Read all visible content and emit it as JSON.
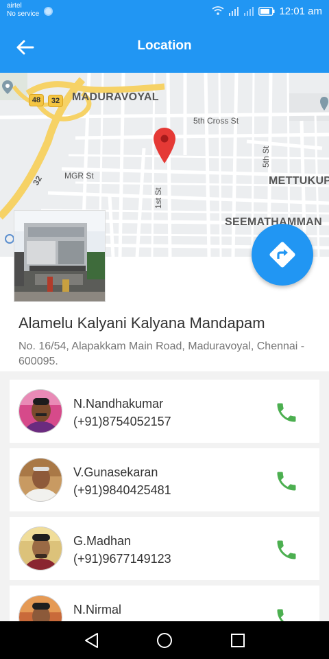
{
  "status_bar": {
    "carrier": "airtel",
    "service": "No service",
    "time": "12:01 am"
  },
  "app_bar": {
    "title": "Location",
    "back_icon": "arrow-left-icon"
  },
  "map": {
    "places": {
      "maduravoyal": "MADURAVOYAL",
      "mettukuppam": "METTUKUP",
      "seemathamman": "SEEMATHAMMAN"
    },
    "streets": {
      "fifth_cross": "5th Cross St",
      "mgr": "MGR St",
      "first": "1st St",
      "fifth": "5th St"
    },
    "road_shields": [
      "48",
      "32",
      "32"
    ],
    "marker_icon": "map-pin-icon",
    "directions_icon": "directions-icon"
  },
  "venue": {
    "name": "Alamelu Kalyani Kalyana Mandapam",
    "address": "No. 16/54, Alapakkam Main Road, Maduravoyal, Chennai - 600095."
  },
  "contacts": [
    {
      "name": "N.Nandhakumar",
      "phone": "(+91)8754052157"
    },
    {
      "name": "V.Gunasekaran",
      "phone": "(+91)9840425481"
    },
    {
      "name": "G.Madhan",
      "phone": "(+91)9677149123"
    },
    {
      "name": "N.Nirmal",
      "phone": ""
    }
  ],
  "colors": {
    "primary": "#2196f3",
    "call_icon": "#4caf50",
    "marker": "#e53935"
  }
}
